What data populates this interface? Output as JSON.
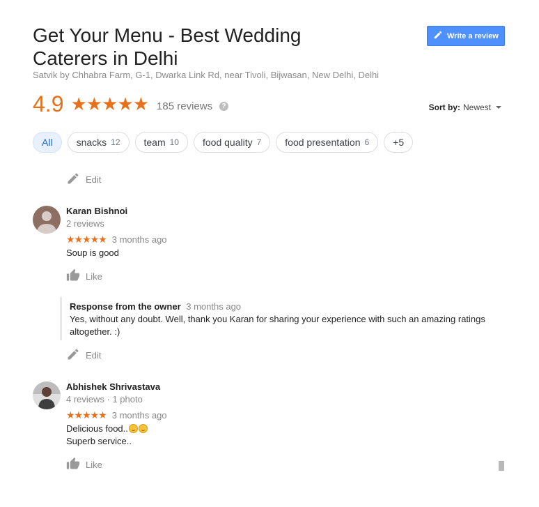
{
  "place": {
    "title": "Get Your Menu - Best Wedding Caterers in Delhi",
    "address": "Satvik by Chhabra Farm, G-1, Dwarka Link Rd, near Tivoli, Bijwasan, New Delhi, Delhi"
  },
  "write_review": {
    "label": "Write a review",
    "icon": "pencil-icon"
  },
  "rating": {
    "value": "4.9",
    "stars": "★★★★★",
    "reviews_label": "185 reviews",
    "help_icon": "?"
  },
  "sort": {
    "label": "Sort by:",
    "value": "Newest"
  },
  "chips": [
    {
      "label": "All",
      "count": ""
    },
    {
      "label": "snacks",
      "count": "12"
    },
    {
      "label": "team",
      "count": "10"
    },
    {
      "label": "food quality",
      "count": "7"
    },
    {
      "label": "food presentation",
      "count": "6"
    },
    {
      "label": "+5",
      "count": ""
    }
  ],
  "actions": {
    "edit": "Edit",
    "like": "Like"
  },
  "reviews": [
    {
      "name": "Karan Bishnoi",
      "meta": "2 reviews",
      "stars": "★★★★★",
      "time": "3 months ago",
      "text": "Soup is good",
      "owner_response": {
        "label": "Response from the owner",
        "time": "3 months ago",
        "text": "Yes, without any doubt. Well, thank you Karan for sharing your experience with such an amazing ratings altogether. :)"
      }
    },
    {
      "name": "Abhishek Shrivastava",
      "meta": "4 reviews · 1 photo",
      "stars": "★★★★★",
      "time": "3 months ago",
      "text_line1": "Delicious food..",
      "text_line2": "Superb service.."
    }
  ],
  "colors": {
    "accent": "#e7711b",
    "button": "#4d90fe",
    "chip_active": "#e8f0fe"
  }
}
